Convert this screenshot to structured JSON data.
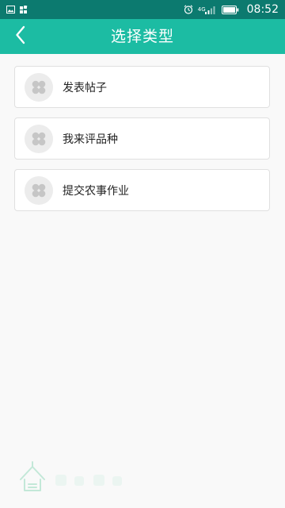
{
  "status_bar": {
    "time": "08:52",
    "network_label": "4G",
    "icons": [
      "image-icon",
      "app-notification-icon",
      "alarm-clock-icon",
      "signal-icon",
      "battery-icon"
    ]
  },
  "header": {
    "title": "选择类型",
    "back_icon": "chevron-left-icon"
  },
  "type_options": [
    {
      "label": "发表帖子",
      "icon": "clover-icon"
    },
    {
      "label": "我来评品种",
      "icon": "clover-icon"
    },
    {
      "label": "提交农事作业",
      "icon": "clover-icon"
    }
  ],
  "colors": {
    "status_bar": "#0c7a6f",
    "title_bar": "#1cbca3",
    "background": "#f9f9f9",
    "card_border": "#e0e0e0",
    "icon_placeholder": "#ececec",
    "watermark": "#8fd9b8"
  }
}
